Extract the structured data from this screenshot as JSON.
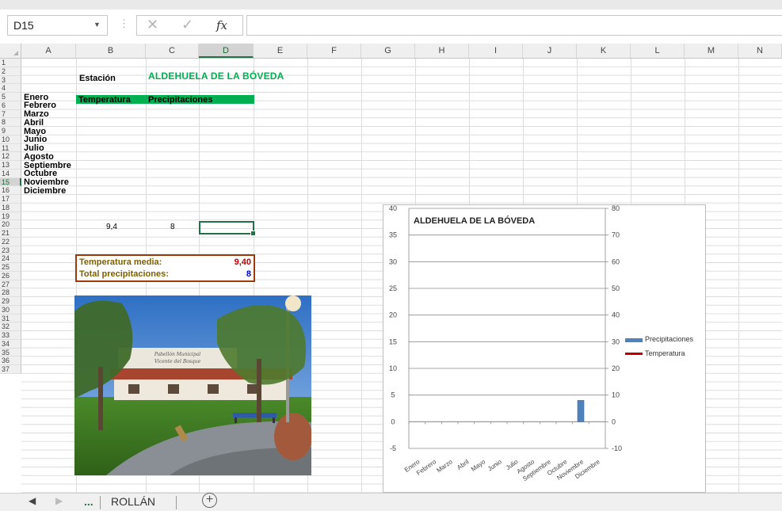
{
  "formula_bar": {
    "name_box": "D15",
    "cancel_glyph": "✕",
    "enter_glyph": "✓",
    "fx_label": "fx",
    "formula": ""
  },
  "columns": [
    "A",
    "B",
    "C",
    "D",
    "E",
    "F",
    "G",
    "H",
    "I",
    "J",
    "K",
    "L",
    "M",
    "N"
  ],
  "selected_column": "D",
  "rows": [
    "1",
    "2",
    "3",
    "4",
    "5",
    "6",
    "7",
    "8",
    "9",
    "10",
    "11",
    "12",
    "13",
    "14",
    "15",
    "16",
    "17",
    "18",
    "19",
    "20",
    "21",
    "22",
    "23",
    "24",
    "25",
    "26",
    "27",
    "28",
    "29",
    "30",
    "31",
    "32",
    "33",
    "34",
    "35",
    "36",
    "37"
  ],
  "selected_row": "15",
  "sheet": {
    "station_label": "Estación",
    "station_name": "ALDEHUELA DE LA BÓVEDA",
    "header_temperature": "Temperatura",
    "header_precipitation": "Precipitaciones",
    "months": [
      "Enero",
      "Febrero",
      "Marzo",
      "Abril",
      "Mayo",
      "Junio",
      "Julio",
      "Agosto",
      "Septiembre",
      "Octubre",
      "Noviembre",
      "Diciembre"
    ],
    "november_temperature": "9,4",
    "november_precipitation": "8",
    "summary": {
      "avg_temp_label": "Temperatura media:",
      "avg_temp_value": "9,40",
      "total_precip_label": "Total precipitaciones:",
      "total_precip_value": "8"
    }
  },
  "photo": {
    "sign_line1": "Pabellón Municipal",
    "sign_line2": "Vicente del Bosque"
  },
  "chart_data": {
    "type": "bar",
    "title": "ALDEHUELA DE LA BÓVEDA",
    "categories": [
      "Enero",
      "Febrero",
      "Marzo",
      "Abril",
      "Mayo",
      "Junio",
      "Julio",
      "Agosto",
      "Septiembre",
      "Octubre",
      "Noviembre",
      "Diciembre"
    ],
    "series": [
      {
        "name": "Precipitaciones",
        "type": "bar",
        "axis": "left",
        "values": [
          0,
          0,
          0,
          0,
          0,
          0,
          0,
          0,
          0,
          0,
          4,
          0
        ]
      },
      {
        "name": "Temperatura",
        "type": "line",
        "axis": "right",
        "values": [
          null,
          null,
          null,
          null,
          null,
          null,
          null,
          null,
          null,
          null,
          null,
          null
        ]
      }
    ],
    "left_axis": {
      "ylim": [
        -5,
        40
      ],
      "ticks": [
        "40",
        "35",
        "30",
        "25",
        "20",
        "15",
        "10",
        "5",
        "0",
        "-5"
      ]
    },
    "right_axis": {
      "ylim": [
        -10,
        80
      ],
      "ticks": [
        "80",
        "70",
        "60",
        "50",
        "40",
        "30",
        "20",
        "10",
        "0",
        "-10"
      ]
    },
    "grid": true,
    "legend_position": "right",
    "colors": {
      "precip": "#4f81bd",
      "temp": "#c00000"
    }
  },
  "tabs": {
    "more": "...",
    "sheet_name": "ROLLÁN",
    "add": "+"
  }
}
